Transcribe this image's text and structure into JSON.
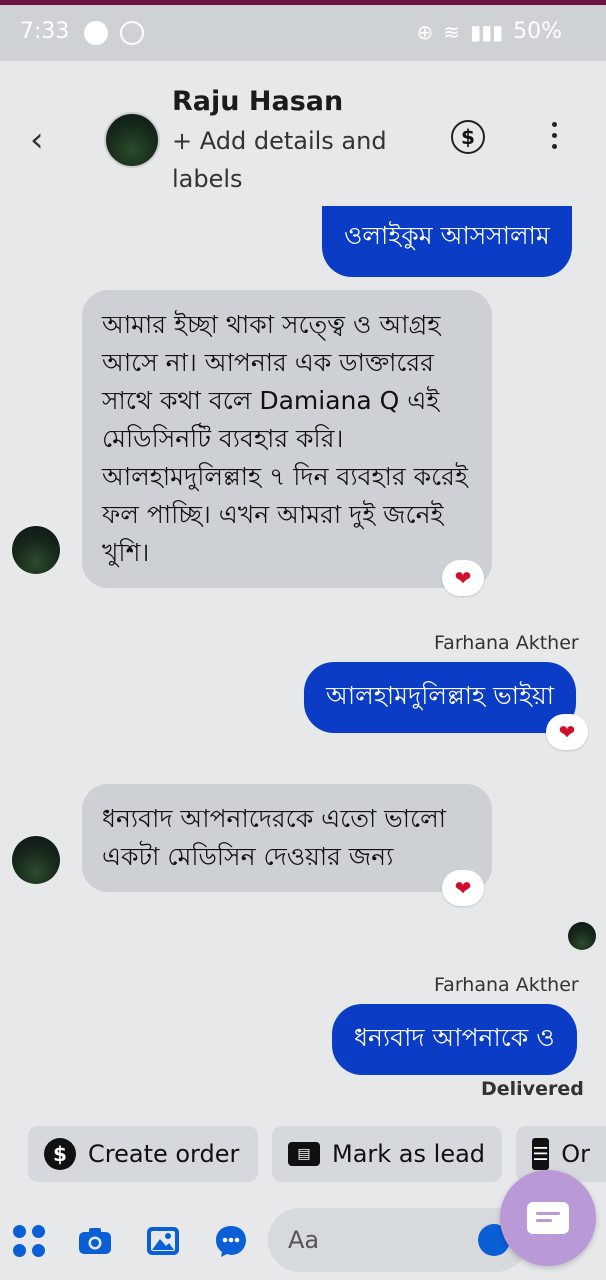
{
  "status": {
    "time": "7:33",
    "battery": "50%"
  },
  "header": {
    "name": "Raju Hasan",
    "subtitle": "+ Add details and labels"
  },
  "messages": {
    "out_1": "ওলাইকুম আসসালাম",
    "in_1": "আমার ইচ্ছা থাকা সত্ত্বে ও আগ্রহ আসে না। আপনার এক ডাক্তারের সাথে কথা বলে Damiana Q এই মেডিসিনটি ব্যবহার করি। আলহামদুলিল্লাহ ৭ দিন ব্যবহার করেই ফল পাচ্ছি। এখন আমরা দুই জনেই খুশি।",
    "sender_1": "Farhana Akther",
    "out_2": "আলহামদুলিল্লাহ ভাইয়া",
    "in_2": "ধন্যবাদ আপনাদেরকে এতো ভালো একটা মেডিসিন দেওয়ার জন্য",
    "sender_2": "Farhana Akther",
    "out_3": "ধন্যবাদ আপনাকে ও",
    "delivered": "Delivered"
  },
  "actions": {
    "create_order": "Create order",
    "mark_lead": "Mark as lead",
    "more": "Or"
  },
  "composer": {
    "placeholder": "Aa"
  },
  "colors": {
    "outgoing": "#0a3cc6",
    "incoming": "#cdd0d4",
    "accent": "#0a5fd6",
    "heart": "#d0102a"
  },
  "icons": [
    "back-icon",
    "dollar-icon",
    "kebab-menu-icon",
    "heart-reaction-icon",
    "apps-icon",
    "camera-icon",
    "gallery-icon",
    "chat-icon",
    "emoji-icon",
    "compose-icon"
  ]
}
